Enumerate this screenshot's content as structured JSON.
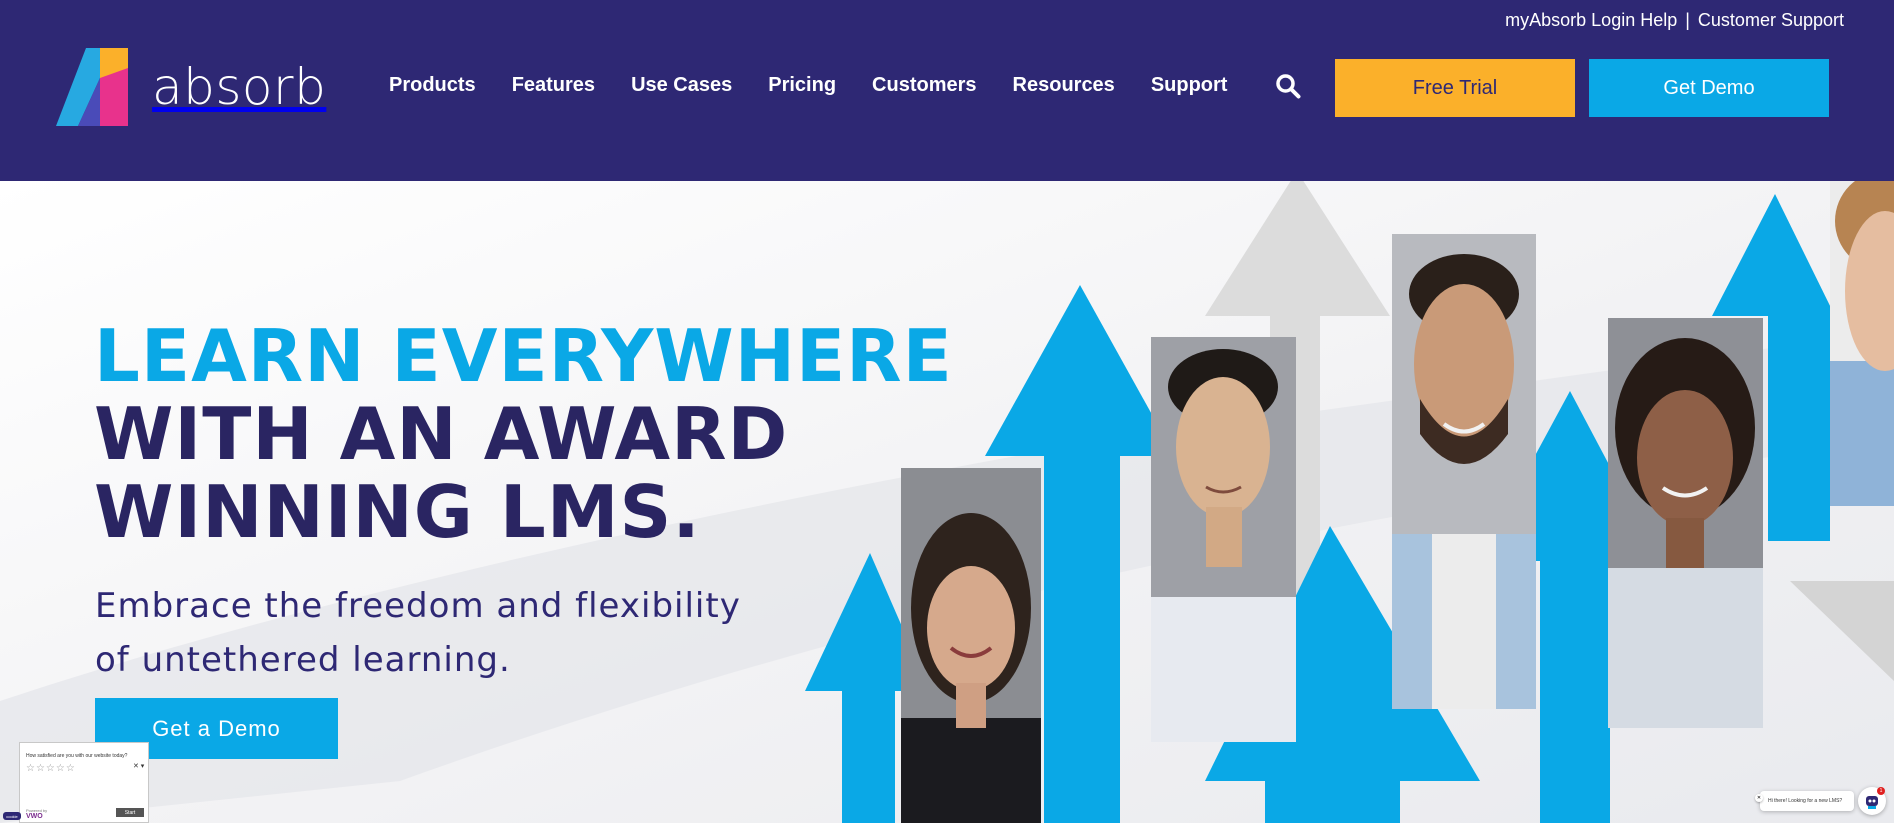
{
  "header": {
    "utility_links": {
      "login_help": "myAbsorb Login Help",
      "separator": "|",
      "support": "Customer Support"
    },
    "logo_text": "absorb",
    "nav": [
      {
        "label": "Products"
      },
      {
        "label": "Features"
      },
      {
        "label": "Use Cases"
      },
      {
        "label": "Pricing"
      },
      {
        "label": "Customers"
      },
      {
        "label": "Resources"
      },
      {
        "label": "Support"
      }
    ],
    "search_icon": "search-icon",
    "free_trial_label": "Free Trial",
    "get_demo_label": "Get Demo"
  },
  "hero": {
    "headline_line1": "LEARN EVERYWHERE",
    "headline_line2": "WITH AN AWARD",
    "headline_line3": "WINNING LMS.",
    "subhead": "Embrace the freedom and flexibility of untethered learning.",
    "cta_label": "Get a Demo"
  },
  "feedback_widget": {
    "question": "How satisfied are you with our website today?",
    "stars": "☆☆☆☆☆",
    "close": "✕ ▾",
    "powered_by": "Powered by",
    "brand": "VWO",
    "start_label": "Start"
  },
  "cookie_tab": {
    "label": "cookie"
  },
  "chat_widget": {
    "message": "Hi there! Looking for a new LMS?",
    "close": "✕",
    "badge": "1"
  },
  "colors": {
    "header_bg": "#2e2874",
    "accent_blue": "#0aa8e6",
    "accent_yellow": "#fbb02a",
    "headline_dark": "#2a2562",
    "logo_pink": "#e8328c"
  }
}
